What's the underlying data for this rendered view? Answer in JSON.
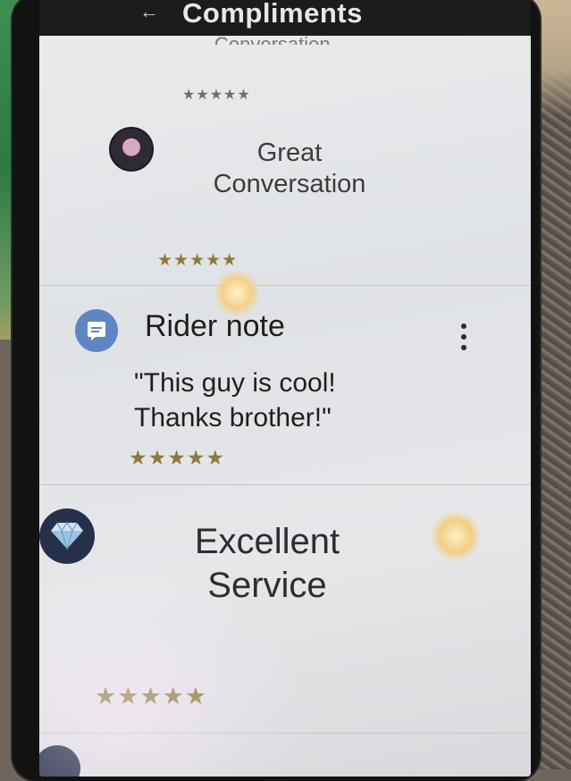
{
  "header": {
    "title": "Compliments",
    "back_icon": "back-arrow-icon"
  },
  "cards": {
    "clipped_title": "Conversation",
    "great_conversation": {
      "title_line1": "Great",
      "title_line2": "Conversation",
      "icon": "chat-badge-icon",
      "stars": "★★★★★"
    },
    "rider_note": {
      "label": "Rider note",
      "text_line1": "\"This guy is cool!",
      "text_line2": "Thanks brother!\"",
      "icon": "note-icon",
      "stars": "★★★★★"
    },
    "excellent_service": {
      "title_line1": "Excellent",
      "title_line2": "Service",
      "icon": "diamond-icon",
      "stars": "★★★★★"
    },
    "top_stars": "★★★★★"
  },
  "colors": {
    "star_gold": "#8e7a3d",
    "note_badge": "#5e86c2",
    "diamond_badge": "#27304a"
  }
}
